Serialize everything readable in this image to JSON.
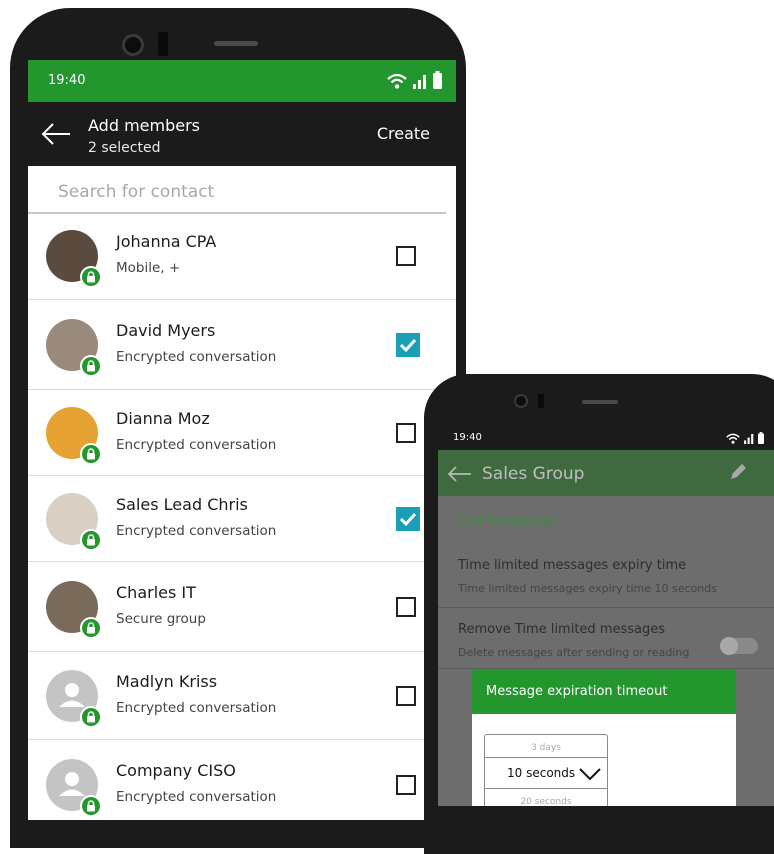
{
  "phone1": {
    "status": {
      "time": "19:40"
    },
    "appbar": {
      "title": "Add members",
      "subtitle": "2 selected",
      "create_label": "Create"
    },
    "search": {
      "placeholder": "Search for contact"
    },
    "contacts": [
      {
        "name": "Johanna CPA",
        "subtitle": "Mobile, +",
        "checked": false,
        "avatar_color": "#5b4a3e"
      },
      {
        "name": "David Myers",
        "subtitle": "Encrypted conversation",
        "checked": true,
        "avatar_color": "#9a8a7c"
      },
      {
        "name": "Dianna Moz",
        "subtitle": "Encrypted conversation",
        "checked": false,
        "avatar_color": "#e6a233"
      },
      {
        "name": "Sales Lead Chris",
        "subtitle": "Encrypted conversation",
        "checked": true,
        "avatar_color": "#d9cfc4"
      },
      {
        "name": "Charles IT",
        "subtitle": "Secure group",
        "checked": false,
        "avatar_color": "#7a6a5a"
      },
      {
        "name": "Madlyn Kriss",
        "subtitle": "Encrypted conversation",
        "checked": false,
        "avatar_color": "#c4c4c4"
      },
      {
        "name": "Company CISO",
        "subtitle": "Encrypted conversation",
        "checked": false,
        "avatar_color": "#c4c4c4"
      }
    ]
  },
  "phone2": {
    "status": {
      "time": "19:40"
    },
    "appbar": {
      "title": "Sales Group"
    },
    "section": "TLM Preferences",
    "prefs": [
      {
        "title": "Time limited messages expiry time",
        "subtitle": "Time limited messages expiry time 10 seconds"
      },
      {
        "title": "Remove Time limited messages",
        "subtitle": "Delete messages after sending or reading"
      }
    ],
    "dialog": {
      "title": "Message expiration timeout",
      "options": {
        "above": "3 days",
        "selected": "10 seconds",
        "below": "20 seconds"
      }
    }
  },
  "colors": {
    "brand_green": "#23962d",
    "check_teal": "#19a0b4",
    "dark": "#1b1b1b"
  }
}
